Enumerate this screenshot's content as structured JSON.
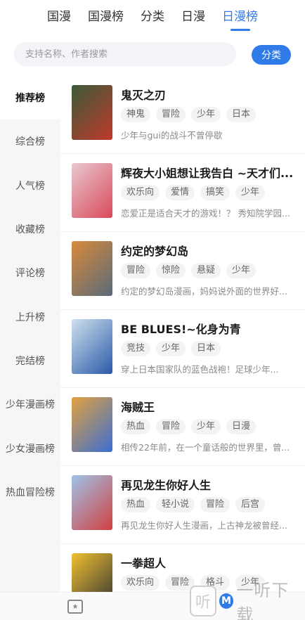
{
  "top_tabs": [
    {
      "label": "国漫"
    },
    {
      "label": "国漫榜"
    },
    {
      "label": "分类"
    },
    {
      "label": "日漫"
    },
    {
      "label": "日漫榜",
      "active": true
    }
  ],
  "search": {
    "placeholder": "支持名称、作者搜索",
    "category_button": "分类"
  },
  "sidebar": {
    "items": [
      {
        "label": "推荐榜",
        "active": true
      },
      {
        "label": "综合榜"
      },
      {
        "label": "人气榜"
      },
      {
        "label": "收藏榜"
      },
      {
        "label": "评论榜"
      },
      {
        "label": "上升榜"
      },
      {
        "label": "完结榜"
      },
      {
        "label": "少年漫画榜"
      },
      {
        "label": "少女漫画榜"
      },
      {
        "label": "热血冒险榜"
      }
    ]
  },
  "list": [
    {
      "title": "鬼灭之刃",
      "tags": [
        "神鬼",
        "冒险",
        "少年",
        "日本"
      ],
      "desc": "少年与gui的战斗不曾停歇"
    },
    {
      "title": "辉夜大小姐想让我告白 ~天才们...",
      "tags": [
        "欢乐向",
        "爱情",
        "搞笑",
        "少年"
      ],
      "desc": "恋爱正是适合天才的游戏！？ 秀知院学园..."
    },
    {
      "title": "约定的梦幻岛",
      "tags": [
        "冒险",
        "惊险",
        "悬疑",
        "少年"
      ],
      "desc": "约定的梦幻岛漫画，妈妈说外面的世界好..."
    },
    {
      "title": "BE BLUES!~化身为青",
      "tags": [
        "竞技",
        "少年",
        "日本"
      ],
      "desc": "穿上日本国家队的蓝色战袍！足球少年..."
    },
    {
      "title": "海贼王",
      "tags": [
        "热血",
        "冒险",
        "少年",
        "日漫"
      ],
      "desc": "相传22年前，在一个童话般的世界里，曾..."
    },
    {
      "title": "再见龙生你好人生",
      "tags": [
        "热血",
        "轻小说",
        "冒险",
        "后宫"
      ],
      "desc": "再见龙生你好人生漫画，上古神龙被曾经..."
    },
    {
      "title": "一拳超人",
      "tags": [
        "欢乐向",
        "冒险",
        "格斗",
        "少年"
      ],
      "desc": ""
    }
  ],
  "covers": [
    {
      "bg": "#3a5b3a",
      "accent": "#c0392b"
    },
    {
      "bg": "#e8c8d0",
      "accent": "#d94a5a"
    },
    {
      "bg": "#d88a3a",
      "accent": "#5a6a7a"
    },
    {
      "bg": "#cfe0ef",
      "accent": "#2a5aa8"
    },
    {
      "bg": "#e3a040",
      "accent": "#3a6fd0"
    },
    {
      "bg": "#9fc3e8",
      "accent": "#d04040"
    },
    {
      "bg": "#f0c030",
      "accent": "#333333"
    }
  ],
  "watermark": {
    "logo": "听",
    "badge": "M",
    "text": "一听下载"
  },
  "bottom_bar": {
    "icon_name": "star-icon"
  }
}
